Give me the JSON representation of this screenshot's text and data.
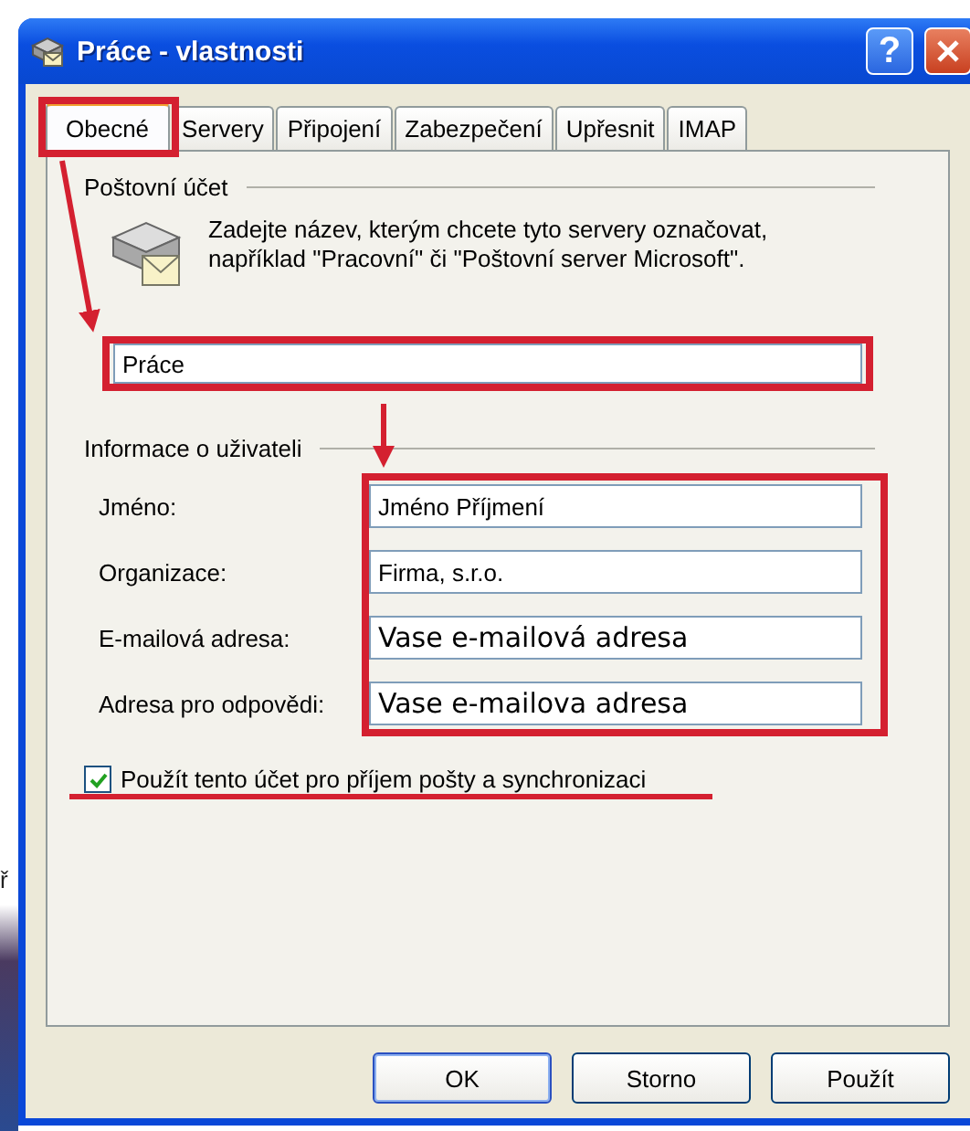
{
  "backdrop_fragment": "ř",
  "window": {
    "title": "Práce - vlastnosti",
    "help_button": "?"
  },
  "tabs": [
    {
      "label": "Obecné",
      "selected": true
    },
    {
      "label": "Servery",
      "selected": false
    },
    {
      "label": "Připojení",
      "selected": false
    },
    {
      "label": "Zabezpečení",
      "selected": false
    },
    {
      "label": "Upřesnit",
      "selected": false
    },
    {
      "label": "IMAP",
      "selected": false
    }
  ],
  "mail_account": {
    "legend": "Poštovní účet",
    "description": "Zadejte název, kterým chcete tyto servery označovat, například \"Pracovní\" či \"Poštovní server Microsoft\".",
    "name_value": "Práce"
  },
  "user_info": {
    "legend": "Informace o uživateli",
    "fields": [
      {
        "label": "Jméno:",
        "value": "Jméno Příjmení",
        "kind": "normal"
      },
      {
        "label": "Organizace:",
        "value": "Firma, s.r.o.",
        "kind": "normal"
      },
      {
        "label": "E-mailová adresa:",
        "value": "Vase e-mailová adresa",
        "kind": "large"
      },
      {
        "label": "Adresa pro odpovědi:",
        "value": "Vase e-mailova adresa",
        "kind": "large"
      }
    ]
  },
  "sync_checkbox": {
    "label": "Použít tento účet pro příjem pošty a synchronizaci",
    "checked": true
  },
  "buttons": [
    {
      "label": "OK",
      "default": true
    },
    {
      "label": "Storno",
      "default": false
    },
    {
      "label": "Použít",
      "default": false
    }
  ]
}
